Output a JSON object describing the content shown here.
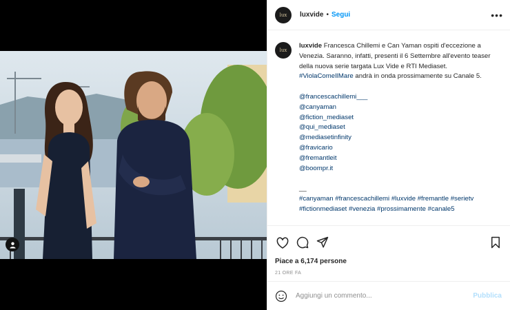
{
  "media": {
    "tag_icon": "user-tag-icon"
  },
  "header": {
    "avatar_text": "lux",
    "username": "luxvide",
    "separator": "•",
    "follow_label": "Segui",
    "more_label": "•••"
  },
  "caption": {
    "username": "luxvide",
    "text": "Francesca Chillemi e Can Yaman ospiti d'eccezione a Venezia. Saranno, infatti, presenti il 6 Settembre all'evento teaser della nuova serie targata Lux Vide e RTI Mediaset.",
    "hashtag_inline": "#ViolaComeIlMare",
    "text_after": "andrà in onda prossimamente su Canale 5.",
    "mentions": [
      "@francescachillemi___",
      "@canyaman",
      "@fiction_mediaset",
      "@qui_mediaset",
      "@mediasetinfinity",
      "@fravicario",
      "@fremantleit",
      "@boompr.it"
    ],
    "divider": "__",
    "hashtags_line1": "#canyaman #francescachillemi #luxvide #fremantle #serietv",
    "hashtags_line2": "#fictionmediaset #venezia #prossimamente #canale5"
  },
  "actions": {
    "like_icon": "heart-icon",
    "comment_icon": "comment-icon",
    "share_icon": "send-icon",
    "save_icon": "bookmark-icon"
  },
  "likes_text": "Piace a 6,174 persone",
  "time_text": "21 ORE FA",
  "comment_box": {
    "placeholder": "Aggiungi un commento...",
    "publish_label": "Pubblica"
  },
  "colors": {
    "link_blue": "#00376b",
    "follow_blue": "#0095f6",
    "publish_disabled": "#b2dffc"
  }
}
